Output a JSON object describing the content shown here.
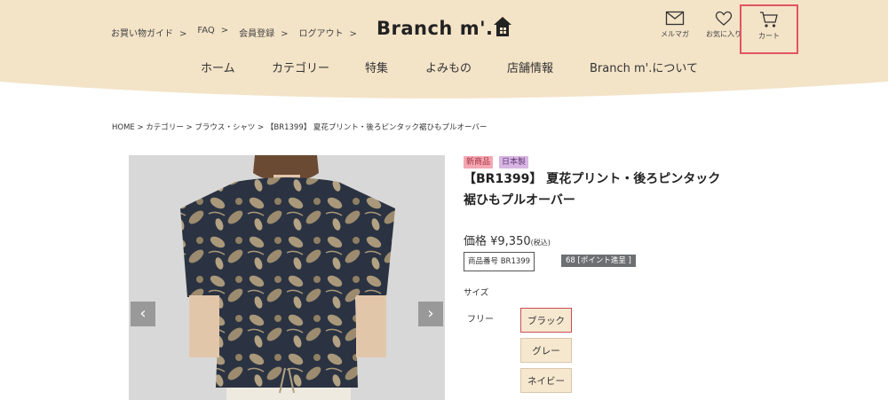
{
  "header": {
    "top_links": [
      "お買い物ガイド",
      "FAQ",
      "会員登録",
      "ログアウト"
    ],
    "arrow": ">",
    "logo": "Branch m'.",
    "utility": {
      "mail_label": "メルマガ",
      "fav_label": "お気に入り",
      "cart_label": "カート"
    },
    "nav": [
      "ホーム",
      "カテゴリー",
      "特集",
      "よみもの",
      "店舗情報",
      "Branch m'.について"
    ]
  },
  "breadcrumb": "HOME > カテゴリー > ブラウス・シャツ > 【BR1399】 夏花プリント・後ろピンタック裾ひもプルオーバー",
  "product": {
    "badges": [
      "新商品",
      "日本製"
    ],
    "title": "【BR1399】 夏花プリント・後ろピンタック裾ひもプルオーバー",
    "price_label": "価格 ¥9,350",
    "tax_label": "(税込)",
    "code": "商品番号 BR1399",
    "points": "68 [ポイント進呈 ]",
    "size_label": "サイズ",
    "size_value": "フリー",
    "colors": [
      "ブラック",
      "グレー",
      "ネイビー"
    ],
    "selected_color": "ブラック"
  },
  "colors": {
    "header_bg": "#f3e3c7",
    "badge_new": "#f2a7b3",
    "badge_japan": "#d7b6e4",
    "option_bg": "#f6e7cf",
    "selected_border": "#c94e57",
    "cart_highlight": "#e05560"
  },
  "icons": {
    "mail": "envelope-icon",
    "fav": "heart-icon",
    "cart": "cart-icon",
    "logo_mark": "house-icon",
    "prev": "chevron-left-icon",
    "next": "chevron-right-icon"
  }
}
